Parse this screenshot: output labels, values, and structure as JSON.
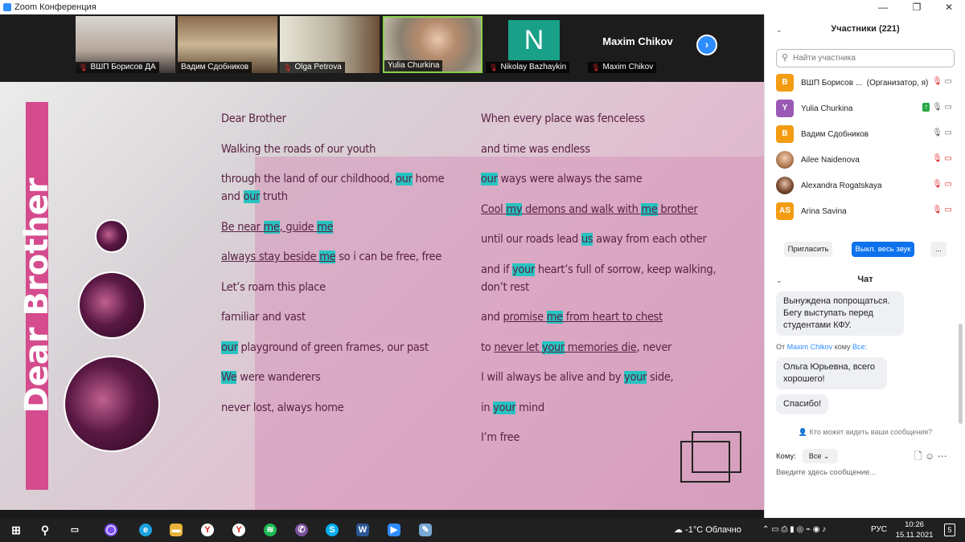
{
  "window": {
    "title": "Zoom Конференция"
  },
  "video_strip": {
    "tiles": [
      {
        "name": "ВШП Борисов ДА",
        "muted": true
      },
      {
        "name": "Вадим Сдобников",
        "muted": false
      },
      {
        "name": "Olga Petrova",
        "muted": true
      },
      {
        "name": "Yulia Churkina",
        "muted": false
      },
      {
        "name": "Nikolay Bazhaykin",
        "muted": true,
        "initial": "N"
      },
      {
        "name": "Maxim Chikov",
        "muted": true,
        "display_name": "Maxim Chikov"
      }
    ]
  },
  "slide": {
    "title": "Dear Brother",
    "left_column": [
      "Dear Brother",
      "Walking the roads of our youth",
      "through the land of our childhood, our home and our truth",
      "Be near me, guide me",
      "always stay beside me so i can be free, free",
      "Let’s roam this place",
      "familiar and vast",
      "our playground of green frames, our past",
      "We were wanderers",
      "never lost, always home"
    ],
    "right_column": [
      "When every place was fenceless",
      "and time was endless",
      "our ways were always the same",
      "Cool my demons and walk with me brother",
      "until our roads lead us away from each other",
      "and if your heart’s full of sorrow, keep walking, don’t rest",
      "and promise me from heart to chest",
      "to never let your memories die, never",
      "I will always be alive and by your side,",
      "in your mind",
      "I’m free"
    ]
  },
  "participants_panel": {
    "title": "Участники (221)",
    "search_placeholder": "Найти участника",
    "participants": [
      {
        "initial": "B",
        "name": "ВШП Борисов ...",
        "role": "(Организатор, я)",
        "color": "#f39c12"
      },
      {
        "initial": "Y",
        "name": "Yulia Churkina",
        "role": "",
        "color": "#9b59b6"
      },
      {
        "initial": "B",
        "name": "Вадим Сдобников",
        "role": "",
        "color": "#f39c12"
      },
      {
        "initial": "",
        "name": "Ailee Naidenova",
        "role": "",
        "color": "#c8a080"
      },
      {
        "initial": "",
        "name": "Alexandra Rogatskaya",
        "role": "",
        "color": "#8a5a40"
      },
      {
        "initial": "AS",
        "name": "Arina Savina",
        "role": "",
        "color": "#f39c12"
      }
    ],
    "invite_label": "Пригласить",
    "mute_all_label": "Выкл. весь звук",
    "more_label": "..."
  },
  "chat_panel": {
    "title": "Чат",
    "messages": [
      {
        "text": "Вынуждена попрощаться. Бегу выступать перед студентами КФУ."
      },
      {
        "text": "Ольга Юрьевна, всего хорошего!"
      },
      {
        "text": "Спасибо!"
      }
    ],
    "meta_from": "От",
    "meta_sender": "Maxim Chikov",
    "meta_to": "кому",
    "meta_recipient": "Все:",
    "visibility_text": "Кто может видеть ваши сообщения?",
    "to_label": "Кому:",
    "to_value": "Все",
    "input_placeholder": "Введите здесь сообщение..."
  },
  "taskbar": {
    "weather": "-1°C Облачно",
    "language": "РУС",
    "time": "10:26",
    "date": "15.11.2021",
    "notification_count": "5"
  }
}
